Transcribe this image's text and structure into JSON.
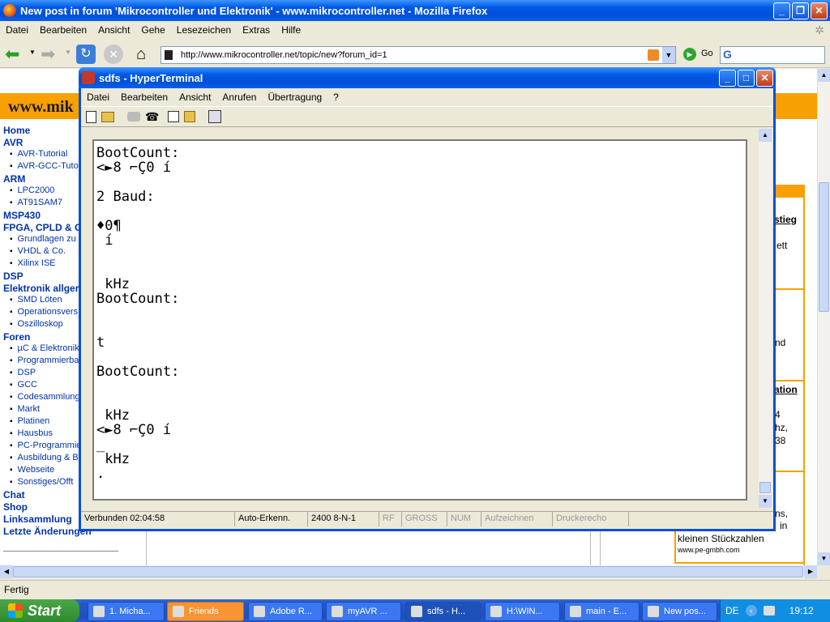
{
  "firefox": {
    "title": "New post in forum 'Mikrocontroller und Elektronik' - www.mikrocontroller.net - Mozilla Firefox",
    "menu": [
      "Datei",
      "Bearbeiten",
      "Ansicht",
      "Gehe",
      "Lesezeichen",
      "Extras",
      "Hilfe"
    ],
    "url": "http://www.mikrocontroller.net/topic/new?forum_id=1",
    "go_label": "Go",
    "status": "Fertig"
  },
  "site": {
    "logo_text": "www.mik",
    "nav": [
      {
        "label": "Home",
        "type": "main"
      },
      {
        "label": "AVR",
        "type": "main"
      },
      {
        "label": "AVR-Tutorial",
        "type": "sub"
      },
      {
        "label": "AVR-GCC-Tuto",
        "type": "sub"
      },
      {
        "label": "ARM",
        "type": "main"
      },
      {
        "label": "LPC2000",
        "type": "sub"
      },
      {
        "label": "AT91SAM7",
        "type": "sub"
      },
      {
        "label": "MSP430",
        "type": "main"
      },
      {
        "label": "FPGA, CPLD & C",
        "type": "main"
      },
      {
        "label": "Grundlagen zu",
        "type": "sub"
      },
      {
        "label": "VHDL & Co.",
        "type": "sub"
      },
      {
        "label": "Xilinx ISE",
        "type": "sub"
      },
      {
        "label": "DSP",
        "type": "main"
      },
      {
        "label": "Elektronik allger",
        "type": "main"
      },
      {
        "label": "SMD Löten",
        "type": "sub"
      },
      {
        "label": "Operationsvers",
        "type": "sub"
      },
      {
        "label": "Oszilloskop",
        "type": "sub"
      },
      {
        "label": "Foren",
        "type": "main"
      },
      {
        "label": "µC & Elektronik",
        "type": "sub"
      },
      {
        "label": "Programmierba",
        "type": "sub"
      },
      {
        "label": "DSP",
        "type": "sub"
      },
      {
        "label": "GCC",
        "type": "sub"
      },
      {
        "label": "Codesammlung",
        "type": "sub"
      },
      {
        "label": "Markt",
        "type": "sub"
      },
      {
        "label": "Platinen",
        "type": "sub"
      },
      {
        "label": "Hausbus",
        "type": "sub"
      },
      {
        "label": "PC-Programmie",
        "type": "sub"
      },
      {
        "label": "Ausbildung & B",
        "type": "sub"
      },
      {
        "label": "Webseite",
        "type": "sub"
      },
      {
        "label": "Sonstiges/Offt",
        "type": "sub"
      },
      {
        "label": "Chat",
        "type": "main"
      },
      {
        "label": "Shop",
        "type": "main"
      },
      {
        "label": "Linksammlung",
        "type": "main"
      },
      {
        "label": "Letzte Änderungen",
        "type": "main"
      }
    ],
    "right_fragments": {
      "stieg": "stieg",
      "ett": "ett",
      "nd": "nd",
      "ation": "ation",
      "4": "4",
      "hz": "hz,",
      "38": "38",
      "ns": "ns,",
      "in": "in",
      "ad_line": "kleinen Stückzahlen",
      "ad_url": "www.pe-gmbh.com"
    }
  },
  "hyperterminal": {
    "title": "sdfs - HyperTerminal",
    "menu": [
      "Datei",
      "Bearbeiten",
      "Ansicht",
      "Anrufen",
      "Übertragung",
      "?"
    ],
    "terminal_lines": [
      "BootCount:",
      "<►8 ⌐Ç0 í",
      "",
      "2 Baud:",
      "",
      "♦0¶",
      " í",
      "",
      "",
      " kHz",
      "BootCount:",
      "",
      "",
      "t",
      "",
      "BootCount:",
      "",
      "",
      " kHz",
      "<►8 ⌐Ç0 í",
      "_",
      " kHz",
      "."
    ],
    "status": {
      "connected": "Verbunden 02:04:58",
      "detect": "Auto-Erkenn.",
      "params": "2400 8-N-1",
      "rf": "RF",
      "gross": "GROSS",
      "num": "NUM",
      "record": "Aufzeichnen",
      "echo": "Druckerecho"
    }
  },
  "taskbar": {
    "start": "Start",
    "items": [
      {
        "label": "1. Micha...",
        "state": "normal"
      },
      {
        "label": "Friends",
        "state": "highlight"
      },
      {
        "label": "Adobe R...",
        "state": "normal"
      },
      {
        "label": "myAVR ...",
        "state": "normal"
      },
      {
        "label": "sdfs - H...",
        "state": "active"
      },
      {
        "label": "H:\\WIN...",
        "state": "normal"
      },
      {
        "label": "main - E...",
        "state": "normal"
      },
      {
        "label": "New pos...",
        "state": "normal"
      }
    ],
    "lang": "DE",
    "clock": "19:12"
  }
}
